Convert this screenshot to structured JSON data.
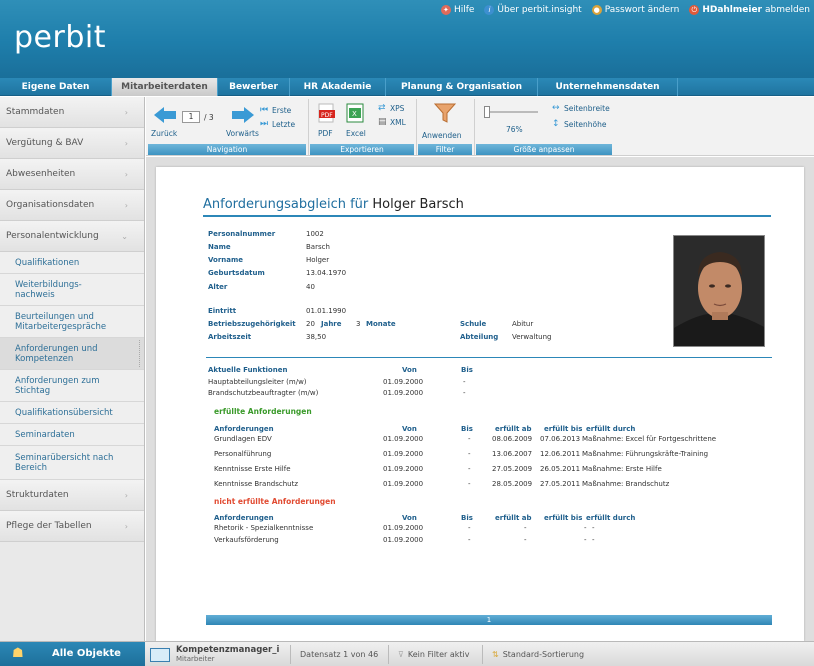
{
  "app": {
    "logo": "perbit",
    "top_links": {
      "help": "Hilfe",
      "about": "Über perbit.insight",
      "password": "Passwort ändern",
      "user": "HDahlmeier",
      "logout": "abmelden"
    }
  },
  "main_nav": {
    "tabs": [
      {
        "label": "Eigene Daten"
      },
      {
        "label": "Mitarbeiterdaten"
      },
      {
        "label": "Bewerber"
      },
      {
        "label": "HR Akademie"
      },
      {
        "label": "Planung & Organisation"
      },
      {
        "label": "Unternehmensdaten"
      }
    ],
    "active": "Mitarbeiterdaten"
  },
  "sidebar": {
    "items": [
      {
        "label": "Stammdaten"
      },
      {
        "label": "Vergütung & BAV"
      },
      {
        "label": "Abwesenheiten"
      },
      {
        "label": "Organisationsdaten"
      },
      {
        "label": "Personalentwicklung"
      }
    ],
    "subitems": [
      {
        "label": "Qualifikationen"
      },
      {
        "label": "Weiterbildungs-nachweis"
      },
      {
        "label": "Beurteilungen und Mitarbeitergespräche"
      },
      {
        "label": "Anforderungen und Kompetenzen"
      },
      {
        "label": "Anforderungen zum Stichtag"
      },
      {
        "label": "Qualifikationsübersicht"
      },
      {
        "label": "Seminardaten"
      },
      {
        "label": "Seminarübersicht nach Bereich"
      }
    ],
    "items_after": [
      {
        "label": "Strukturdaten"
      },
      {
        "label": "Pflege der Tabellen"
      }
    ]
  },
  "toolbar": {
    "navigation": {
      "back": "Zurück",
      "forward": "Vorwärts",
      "first": "Erste",
      "last": "Letzte",
      "page_value": "1",
      "page_total": "/ 3",
      "group_label": "Navigation"
    },
    "export": {
      "pdf": "PDF",
      "excel": "Excel",
      "xps": "XPS",
      "xml": "XML",
      "group_label": "Exportieren"
    },
    "filter": {
      "apply": "Anwenden",
      "group_label": "Filter"
    },
    "size": {
      "zoom": "76%",
      "zoom_level": 0.76,
      "page_width": "Seitenbreite",
      "page_height": "Seitenhöhe",
      "group_label": "Größe anpassen"
    }
  },
  "report": {
    "title_prefix": "Anforderungsabgleich für",
    "title_name": "Holger Barsch",
    "fields": {
      "personalnummer": {
        "label": "Personalnummer",
        "value": "1002"
      },
      "name": {
        "label": "Name",
        "value": "Barsch"
      },
      "vorname": {
        "label": "Vorname",
        "value": "Holger"
      },
      "geburtsdatum": {
        "label": "Geburtsdatum",
        "value": "13.04.1970"
      },
      "alter": {
        "label": "Alter",
        "value": "40"
      },
      "eintritt": {
        "label": "Eintritt",
        "value": "01.01.1990"
      },
      "betrieb": {
        "label": "Betriebszugehörigkeit",
        "years": "20",
        "years_label": "Jahre",
        "months": "3",
        "months_label": "Monate"
      },
      "arbeitszeit": {
        "label": "Arbeitszeit",
        "value": "38,50"
      },
      "schule": {
        "label": "Schule",
        "value": "Abitur"
      },
      "abteilung": {
        "label": "Abteilung",
        "value": "Verwaltung"
      }
    },
    "functions": {
      "header": "Aktuelle Funktionen",
      "col_von": "Von",
      "col_bis": "Bis",
      "rows": [
        {
          "name": "Hauptabteilungsleiter (m/w)",
          "von": "01.09.2000",
          "bis": "-"
        },
        {
          "name": "Brandschutzbeauftragter (m/w)",
          "von": "01.09.2000",
          "bis": "-"
        }
      ]
    },
    "fulfilled": {
      "section": "erfüllte Anforderungen",
      "headers": {
        "name": "Anforderungen",
        "von": "Von",
        "bis": "Bis",
        "ab": "erfüllt ab",
        "bis2": "erfüllt bis",
        "durch": "erfüllt durch"
      },
      "rows": [
        {
          "name": "Grundlagen EDV",
          "von": "01.09.2000",
          "bis": "-",
          "ab": "08.06.2009",
          "bis2": "07.06.2013",
          "durch": "Maßnahme: Excel für Fortgeschrittene"
        },
        {
          "name": "Personalführung",
          "von": "01.09.2000",
          "bis": "-",
          "ab": "13.06.2007",
          "bis2": "12.06.2011",
          "durch": "Maßnahme: Führungskräfte-Training"
        },
        {
          "name": "Kenntnisse Erste Hilfe",
          "von": "01.09.2000",
          "bis": "-",
          "ab": "27.05.2009",
          "bis2": "26.05.2011",
          "durch": "Maßnahme: Erste Hilfe"
        },
        {
          "name": "Kenntnisse Brandschutz",
          "von": "01.09.2000",
          "bis": "-",
          "ab": "28.05.2009",
          "bis2": "27.05.2011",
          "durch": "Maßnahme: Brandschutz"
        }
      ]
    },
    "unfulfilled": {
      "section": "nicht erfüllte Anforderungen",
      "headers": {
        "name": "Anforderungen",
        "von": "Von",
        "bis": "Bis",
        "ab": "erfüllt ab",
        "bis2": "erfüllt bis",
        "durch": "erfüllt durch"
      },
      "rows": [
        {
          "name": "Rhetorik - Spezialkenntnisse",
          "von": "01.09.2000",
          "bis": "-",
          "ab": "-",
          "bis2": "-",
          "durch": "-"
        },
        {
          "name": "Verkaufsförderung",
          "von": "01.09.2000",
          "bis": "-",
          "ab": "-",
          "bis2": "-",
          "durch": "-"
        }
      ]
    },
    "pager": "1"
  },
  "footer": {
    "all_objects": "Alle Objekte",
    "module_title": "Kompetenzmanager_i",
    "module_sub": "Mitarbeiter",
    "record": "Datensatz 1 von 46",
    "filter": "Kein Filter aktiv",
    "sort": "Standard-Sortierung"
  },
  "colors": {
    "brand_blue": "#1e7eab",
    "accent_green": "#3a9a2a",
    "accent_red": "#e14b32"
  }
}
